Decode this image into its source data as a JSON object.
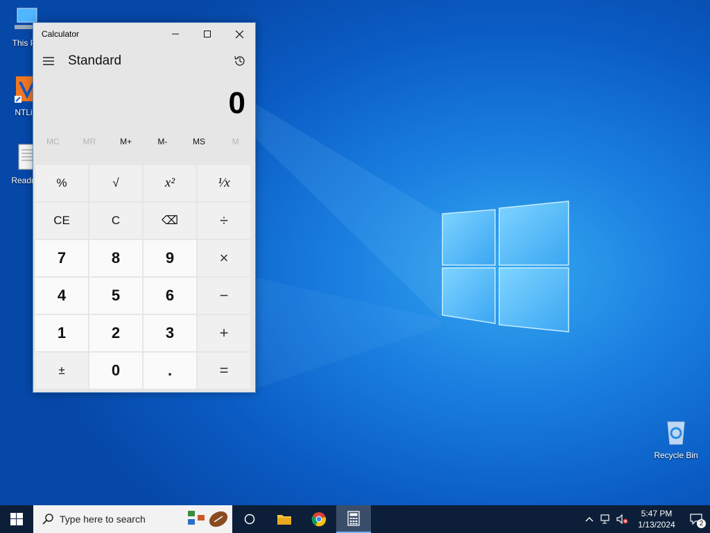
{
  "desktop": {
    "icons": [
      {
        "label": "This PC"
      },
      {
        "label": "NTLite"
      },
      {
        "label": "Readme"
      },
      {
        "label": "Recycle Bin"
      }
    ]
  },
  "calculator": {
    "window_title": "Calculator",
    "mode": "Standard",
    "display_value": "0",
    "memory": [
      "MC",
      "MR",
      "M+",
      "M-",
      "MS",
      "M"
    ],
    "keys": [
      "%",
      "√",
      "x²",
      "¹⁄x",
      "CE",
      "C",
      "⌫",
      "÷",
      "7",
      "8",
      "9",
      "×",
      "4",
      "5",
      "6",
      "−",
      "1",
      "2",
      "3",
      "+",
      "±",
      "0",
      ".",
      "="
    ]
  },
  "taskbar": {
    "search_placeholder": "Type here to search",
    "time": "5:47 PM",
    "date": "1/13/2024",
    "notification_count": "2"
  },
  "colors": {
    "desktop_blue": "#0a5cc4",
    "taskbar": "#0d1f38",
    "calc_bg": "#e6e6e6"
  }
}
